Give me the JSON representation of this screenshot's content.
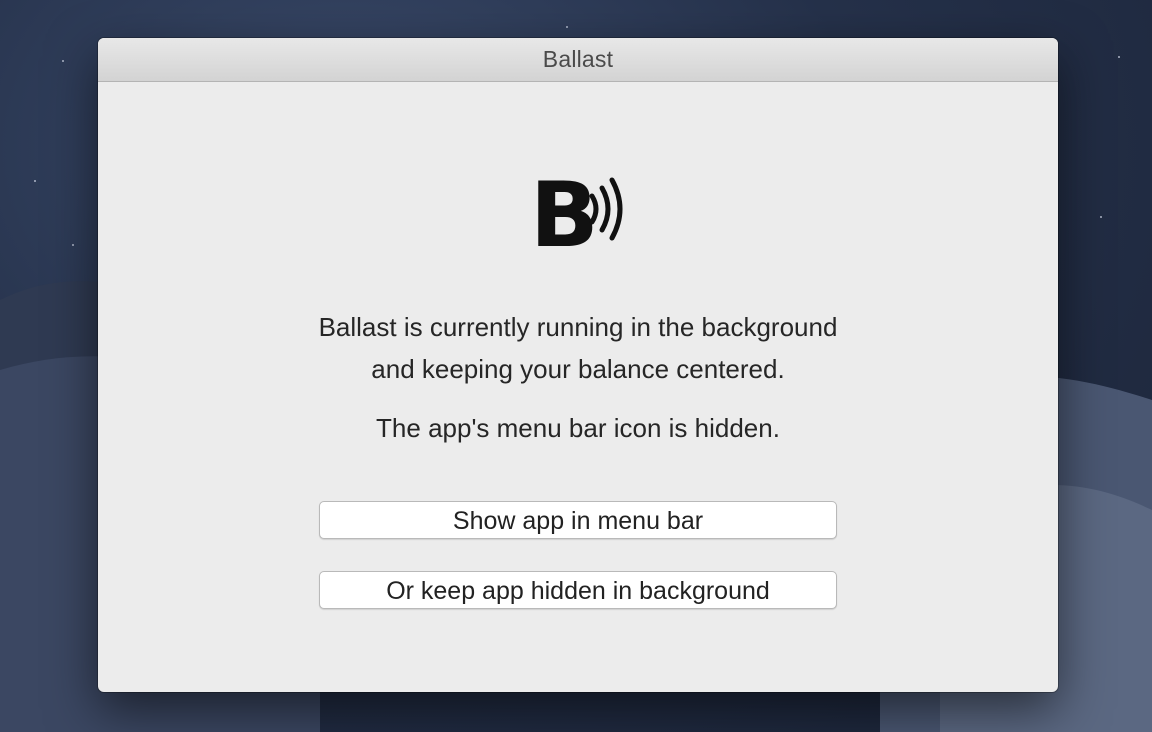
{
  "window": {
    "title": "Ballast"
  },
  "logo": {
    "icon": "ballast-logo-icon",
    "letter": "B"
  },
  "message": {
    "line1": "Ballast is currently running in the background",
    "line2": "and keeping your balance centered.",
    "status": "The app's menu bar icon is hidden."
  },
  "buttons": {
    "show_label": "Show app in menu bar",
    "hide_label": "Or keep app hidden in background"
  },
  "colors": {
    "window_bg": "#ececec",
    "desktop_bg": "#25314a",
    "text": "#262626"
  }
}
